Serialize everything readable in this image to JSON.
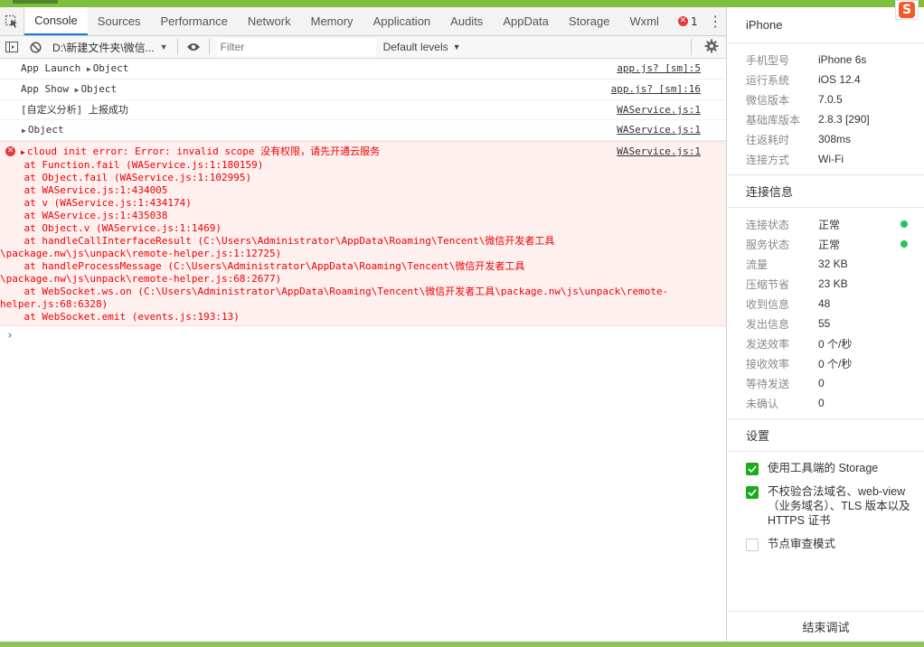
{
  "devtools": {
    "tabs": [
      {
        "label": "Console",
        "active": true
      },
      {
        "label": "Sources"
      },
      {
        "label": "Performance"
      },
      {
        "label": "Network"
      },
      {
        "label": "Memory"
      },
      {
        "label": "Application"
      },
      {
        "label": "Audits"
      },
      {
        "label": "AppData"
      },
      {
        "label": "Storage"
      },
      {
        "label": "Wxml"
      }
    ],
    "error_count": "1",
    "toolbar": {
      "context": "D:\\新建文件夹\\微信...",
      "filter_placeholder": "Filter",
      "levels": "Default levels"
    },
    "messages": [
      {
        "prefix": "App Launch",
        "obj": "Object",
        "source": "app.js? [sm]:5"
      },
      {
        "prefix": "App Show",
        "obj": "Object",
        "source": "app.js? [sm]:16"
      },
      {
        "text": "[自定义分析] 上报成功",
        "source": "WAService.js:1"
      },
      {
        "obj": "Object",
        "source": "WAService.js:1"
      }
    ],
    "error": {
      "headline": "cloud init error:  Error: invalid scope 没有权限，请先开通云服务",
      "source": "WAService.js:1",
      "stack": [
        "    at Function.fail (WAService.js:1:180159)",
        "    at Object.fail (WAService.js:1:102995)",
        "    at WAService.js:1:434005",
        "    at v (WAService.js:1:434174)",
        "    at WAService.js:1:435038",
        "    at Object.v (WAService.js:1:1469)",
        "    at handleCallInterfaceResult (C:\\Users\\Administrator\\AppData\\Roaming\\Tencent\\微信开发者工具",
        "\\package.nw\\js\\unpack\\remote-helper.js:1:12725)",
        "    at handleProcessMessage (C:\\Users\\Administrator\\AppData\\Roaming\\Tencent\\微信开发者工具",
        "\\package.nw\\js\\unpack\\remote-helper.js:68:2677)",
        "    at WebSocket.ws.on (C:\\Users\\Administrator\\AppData\\Roaming\\Tencent\\微信开发者工具\\package.nw\\js\\unpack\\remote-",
        "helper.js:68:6328)",
        "    at WebSocket.emit (events.js:193:13)"
      ]
    },
    "prompt": "›"
  },
  "panel": {
    "device_title": "iPhone",
    "device_info": [
      {
        "k": "手机型号",
        "v": "iPhone 6s"
      },
      {
        "k": "运行系统",
        "v": "iOS 12.4"
      },
      {
        "k": "微信版本",
        "v": "7.0.5"
      },
      {
        "k": "基础库版本",
        "v": "2.8.3 [290]"
      },
      {
        "k": "往返耗时",
        "v": "308ms"
      },
      {
        "k": "连接方式",
        "v": "Wi-Fi"
      }
    ],
    "conn_title": "连接信息",
    "conn_info": [
      {
        "k": "连接状态",
        "v": "正常",
        "dot": true
      },
      {
        "k": "服务状态",
        "v": "正常",
        "dot": true
      },
      {
        "k": "流量",
        "v": "32 KB"
      },
      {
        "k": "压缩节省",
        "v": "23 KB"
      },
      {
        "k": "收到信息",
        "v": "48"
      },
      {
        "k": "发出信息",
        "v": "55"
      },
      {
        "k": "发送效率",
        "v": "0 个/秒"
      },
      {
        "k": "接收效率",
        "v": "0 个/秒"
      },
      {
        "k": "等待发送",
        "v": "0"
      },
      {
        "k": "未确认",
        "v": "0"
      }
    ],
    "settings_title": "设置",
    "settings": [
      {
        "label": "使用工具端的 Storage",
        "checked": true
      },
      {
        "label": "不校验合法域名、web-view（业务域名）、TLS 版本以及 HTTPS 证书",
        "checked": true
      },
      {
        "label": "节点审查模式",
        "checked": false
      }
    ],
    "end_button": "结束调试"
  },
  "ime": {
    "label": "S"
  },
  "colors": {
    "accent": "#1a73e8",
    "error": "#e53935",
    "ok": "#22c55e",
    "check": "#1aad19"
  }
}
